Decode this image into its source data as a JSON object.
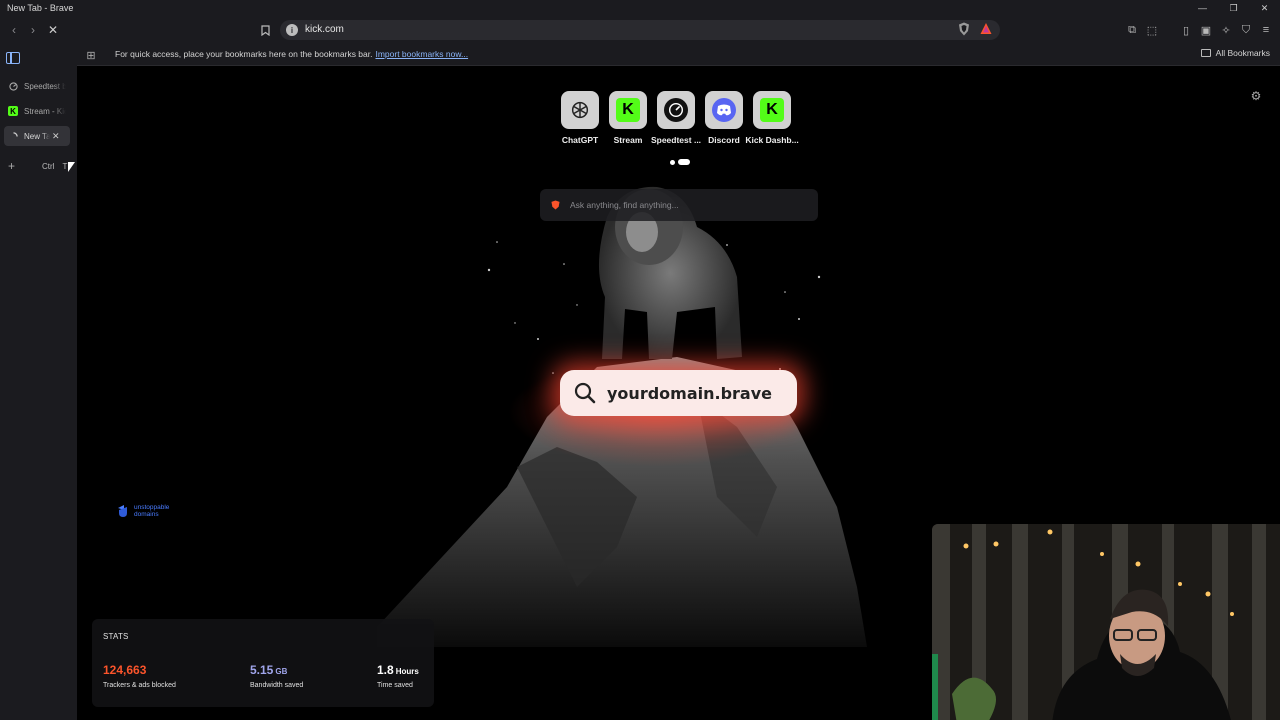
{
  "window": {
    "title": "New Tab - Brave"
  },
  "toolbar": {
    "url": "kick.com"
  },
  "bookmarks_bar": {
    "hint": "For quick access, place your bookmarks here on the bookmarks bar.",
    "import_link": "Import bookmarks now...",
    "all_bookmarks": "All Bookmarks"
  },
  "tabs": [
    {
      "label": "Speedtest by Ookla",
      "icon": "speedtest-icon"
    },
    {
      "label": "Stream - Kick",
      "icon": "kick-icon"
    },
    {
      "label": "New Tab",
      "icon": "loading-icon",
      "active": true
    }
  ],
  "new_tab_shortcut": {
    "key1": "Ctrl",
    "key2": "T"
  },
  "top_sites": [
    {
      "name": "ChatGPT",
      "icon": "chatgpt-icon"
    },
    {
      "name": "Stream",
      "icon": "kick-icon"
    },
    {
      "name": "Speedtest ...",
      "icon": "speedtest-icon"
    },
    {
      "name": "Discord",
      "icon": "discord-icon"
    },
    {
      "name": "Kick Dashb...",
      "icon": "kick-icon"
    }
  ],
  "search": {
    "placeholder": "Ask anything, find anything..."
  },
  "background_overlay": {
    "domain_text": "yourdomain.brave"
  },
  "sponsor": {
    "text": "unstoppable domains"
  },
  "stats": {
    "heading": "STATS",
    "trackers": {
      "value": "124,663",
      "label": "Trackers & ads blocked",
      "color": "#fb542b"
    },
    "bandwidth": {
      "value": "5.15",
      "unit": "GB",
      "label": "Bandwidth saved",
      "color": "#a0a5eb"
    },
    "time": {
      "value": "1.8",
      "unit": "Hours",
      "label": "Time saved",
      "color": "#ffffff"
    }
  },
  "colors": {
    "brave_orange": "#fb542b",
    "kick_green": "#53fc18",
    "discord": "#5865f2"
  }
}
